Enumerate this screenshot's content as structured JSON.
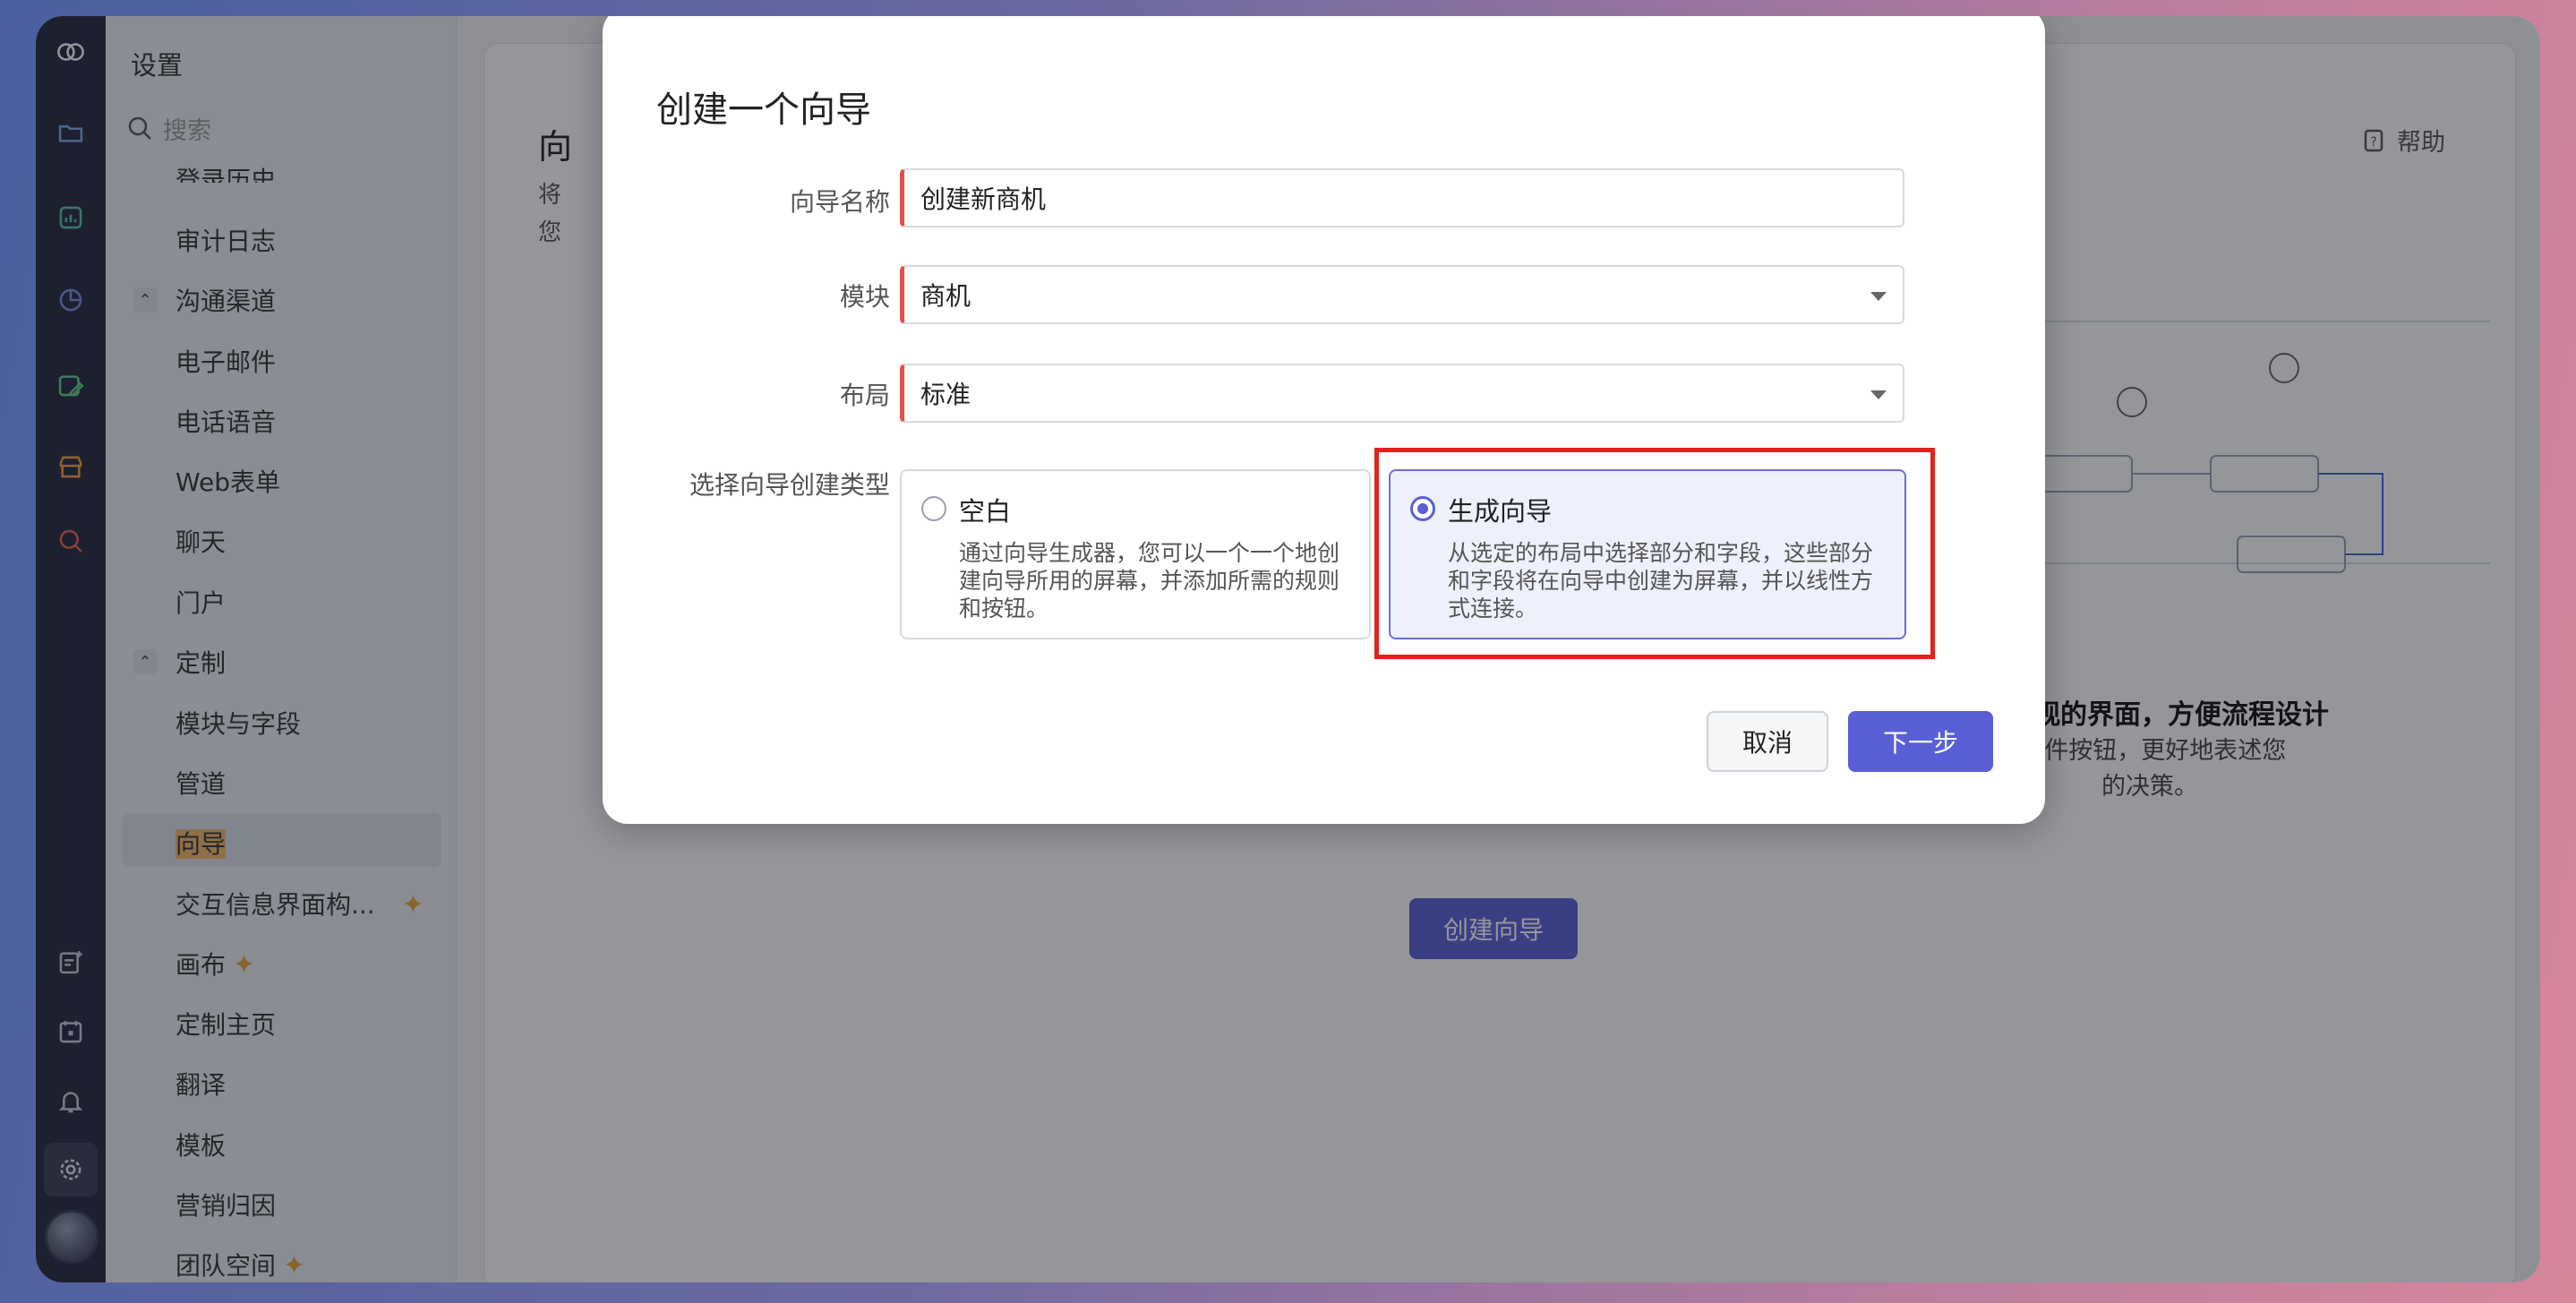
{
  "sidebar": {
    "title": "设置",
    "search_placeholder": "搜索",
    "items": [
      {
        "label": "登录历史"
      },
      {
        "label": "审计日志"
      },
      {
        "label": "沟通渠道",
        "group": true
      },
      {
        "label": "电子邮件"
      },
      {
        "label": "电话语音"
      },
      {
        "label": "Web表单"
      },
      {
        "label": "聊天"
      },
      {
        "label": "门户"
      },
      {
        "label": "定制",
        "group": true
      },
      {
        "label": "模块与字段"
      },
      {
        "label": "管道"
      },
      {
        "label": "向导",
        "selected": true
      },
      {
        "label": "交互信息界面构...",
        "sparkle": true
      },
      {
        "label": "画布",
        "sparkle": true
      },
      {
        "label": "定制主页"
      },
      {
        "label": "翻译"
      },
      {
        "label": "模板"
      },
      {
        "label": "营销归因"
      },
      {
        "label": "团队空间",
        "sparkle": true
      }
    ]
  },
  "main": {
    "page_title": "向",
    "desc_line1": "将",
    "desc_line2": "您",
    "help_label": "帮助",
    "feature_title": "直观的界面，方便流程设计",
    "feature_desc": "i条件按钮，更好地表述您的决策。",
    "create_button": "创建向导"
  },
  "modal": {
    "title": "创建一个向导",
    "name_label": "向导名称",
    "name_value": "创建新商机",
    "module_label": "模块",
    "module_value": "商机",
    "layout_label": "布局",
    "layout_value": "标准",
    "type_label": "选择向导创建类型",
    "options": [
      {
        "title": "空白",
        "desc": "通过向导生成器，您可以一个一个地创建向导所用的屏幕，并添加所需的规则和按钮。",
        "selected": false
      },
      {
        "title": "生成向导",
        "desc": "从选定的布局中选择部分和字段，这些部分和字段将在向导中创建为屏幕，并以线性方式连接。",
        "selected": true
      }
    ],
    "cancel_label": "取消",
    "next_label": "下一步"
  },
  "colors": {
    "accent": "#5a5fd6",
    "required_marker": "#e0534c",
    "highlight_box": "#e0231c",
    "rail_bg": "#252a3d"
  }
}
